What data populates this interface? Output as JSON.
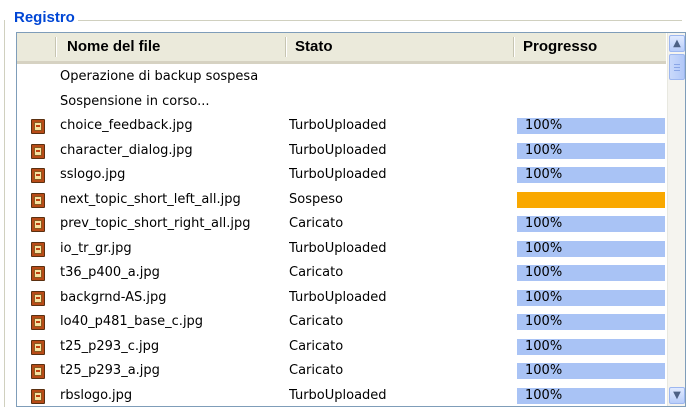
{
  "group_title": "Registro",
  "columns": {
    "name": "Nome del file",
    "state": "Stato",
    "progress": "Progresso"
  },
  "colors": {
    "progress_done": "#a9c3f5",
    "progress_paused": "#f9a800",
    "group_title": "#0046d5"
  },
  "rows": [
    {
      "icon": null,
      "name": "Operazione di backup sospesa",
      "state": "",
      "progress": null
    },
    {
      "icon": null,
      "name": "Sospensione in corso...",
      "state": "",
      "progress": null
    },
    {
      "icon": "image-file-icon",
      "name": "choice_feedback.jpg",
      "state": "TurboUploaded",
      "progress": "100%"
    },
    {
      "icon": "image-file-icon",
      "name": "character_dialog.jpg",
      "state": "TurboUploaded",
      "progress": "100%"
    },
    {
      "icon": "image-file-icon",
      "name": "sslogo.jpg",
      "state": "TurboUploaded",
      "progress": "100%"
    },
    {
      "icon": "image-file-icon",
      "name": "next_topic_short_left_all.jpg",
      "state": "Sospeso",
      "progress": "",
      "paused": true
    },
    {
      "icon": "image-file-icon",
      "name": "prev_topic_short_right_all.jpg",
      "state": "Caricato",
      "progress": "100%"
    },
    {
      "icon": "image-file-icon",
      "name": "io_tr_gr.jpg",
      "state": "TurboUploaded",
      "progress": "100%"
    },
    {
      "icon": "image-file-icon",
      "name": "t36_p400_a.jpg",
      "state": "Caricato",
      "progress": "100%"
    },
    {
      "icon": "image-file-icon",
      "name": "backgrnd-AS.jpg",
      "state": "TurboUploaded",
      "progress": "100%"
    },
    {
      "icon": "image-file-icon",
      "name": "lo40_p481_base_c.jpg",
      "state": "Caricato",
      "progress": "100%"
    },
    {
      "icon": "image-file-icon",
      "name": "t25_p293_c.jpg",
      "state": "Caricato",
      "progress": "100%"
    },
    {
      "icon": "image-file-icon",
      "name": "t25_p293_a.jpg",
      "state": "Caricato",
      "progress": "100%"
    },
    {
      "icon": "image-file-icon",
      "name": "rbslogo.jpg",
      "state": "TurboUploaded",
      "progress": "100%"
    }
  ]
}
